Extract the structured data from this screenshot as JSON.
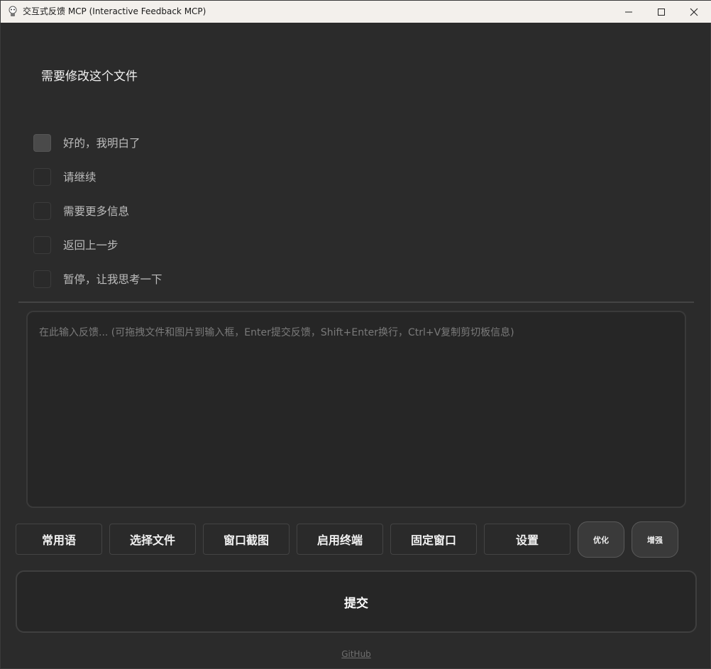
{
  "window": {
    "title": "交互式反馈 MCP (Interactive Feedback MCP)",
    "titlebar_color": "#f3f0ec",
    "background_color": "#2b2b2b"
  },
  "prompt": {
    "text": "需要修改这个文件"
  },
  "options": [
    {
      "label": "好的，我明白了",
      "checked": false
    },
    {
      "label": "请继续",
      "checked": false
    },
    {
      "label": "需要更多信息",
      "checked": false
    },
    {
      "label": "返回上一步",
      "checked": false
    },
    {
      "label": "暂停，让我思考一下",
      "checked": false
    }
  ],
  "feedback": {
    "value": "",
    "placeholder": "在此输入反馈... (可拖拽文件和图片到输入框，Enter提交反馈，Shift+Enter换行，Ctrl+V复制剪切板信息)"
  },
  "toolbar": {
    "buttons": [
      {
        "label": "常用语"
      },
      {
        "label": "选择文件"
      },
      {
        "label": "窗口截图"
      },
      {
        "label": "启用终端"
      },
      {
        "label": "固定窗口"
      },
      {
        "label": "设置"
      }
    ],
    "optimize_label": "优化",
    "enhance_label": "增强"
  },
  "submit": {
    "label": "提交"
  },
  "footer": {
    "link_text": "GitHub"
  }
}
